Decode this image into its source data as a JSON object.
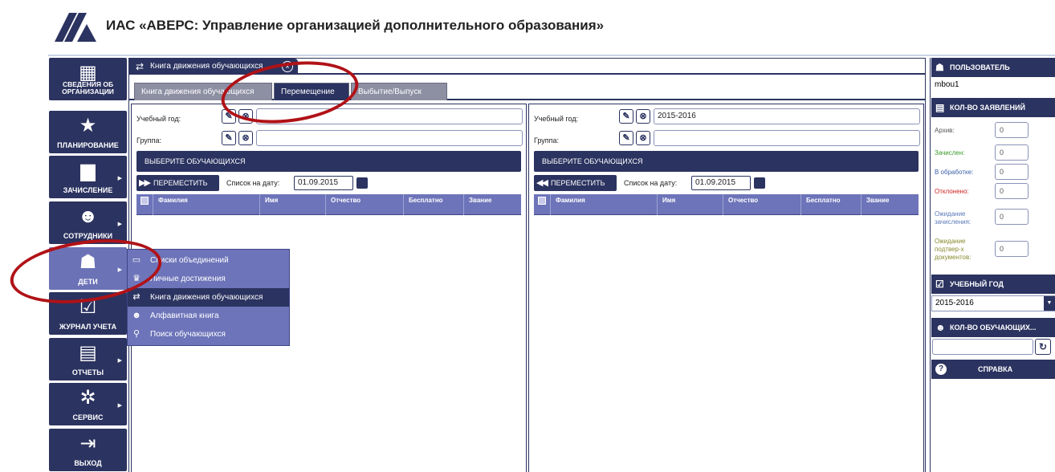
{
  "app": {
    "title": "ИАС «АВЕРС: Управление организацией дополнительного образования»"
  },
  "nav": [
    {
      "label": "СВЕДЕНИЯ ОБ ОРГАНИЗАЦИИ",
      "icon": "building-icon",
      "glyph": "▦"
    },
    {
      "label": "ПЛАНИРОВАНИЕ",
      "icon": "star-icon",
      "glyph": "★"
    },
    {
      "label": "ЗАЧИСЛЕНИЕ",
      "icon": "briefcase-icon",
      "glyph": "▆"
    },
    {
      "label": "СОТРУДНИКИ",
      "icon": "people-icon",
      "glyph": "☻"
    },
    {
      "label": "ДЕТИ",
      "icon": "person-icon",
      "glyph": "☗"
    },
    {
      "label": "ЖУРНАЛ УЧЕТА",
      "icon": "checkbox-icon",
      "glyph": "☑"
    },
    {
      "label": "ОТЧЕТЫ",
      "icon": "printer-icon",
      "glyph": "▤"
    },
    {
      "label": "СЕРВИС",
      "icon": "gears-icon",
      "glyph": "✲"
    },
    {
      "label": "ВЫХОД",
      "icon": "exit-icon",
      "glyph": "⇥"
    }
  ],
  "flyout": [
    {
      "label": "Списки объединений",
      "icon": "book-icon",
      "glyph": "▭"
    },
    {
      "label": "Личные достижения",
      "icon": "trophy-icon",
      "glyph": "♛"
    },
    {
      "label": "Книга движения обучающихся",
      "icon": "swap-icon",
      "glyph": "⇄"
    },
    {
      "label": "Алфавитная книга",
      "icon": "group-icon",
      "glyph": "☻"
    },
    {
      "label": "Поиск обучающихся",
      "icon": "search-icon",
      "glyph": "⚲"
    }
  ],
  "window": {
    "title": "Книга движения обучающихся",
    "close": "×"
  },
  "tabs": [
    "Книга движения обучающихся",
    "Перемещение",
    "Выбытие/Выпуск"
  ],
  "left": {
    "year_label": "Учебный год:",
    "year_value": "",
    "group_label": "Группа:",
    "group_value": "",
    "section": "ВЫБЕРИТЕ ОБУЧАЮЩИХСЯ",
    "move": "ПЕРЕМЕСТИТЬ",
    "date_label": "Список на дату:",
    "date": "01.09.2015"
  },
  "right": {
    "year_label": "Учебный год:",
    "year_value": "2015-2016",
    "group_label": "Группа:",
    "group_value": "",
    "section": "ВЫБЕРИТЕ ОБУЧАЮЩИХСЯ",
    "move": "ПЕРЕМЕСТИТЬ",
    "date_label": "Список на дату:",
    "date": "01.09.2015"
  },
  "columns": [
    "Фамилия",
    "Имя",
    "Отчество",
    "Бесплатно",
    "Звание"
  ],
  "side": {
    "user_header": "ПОЛЬЗОВАТЕЛЬ",
    "user": "mbou1",
    "count_header": "КОЛ-ВО ЗАЯВЛЕНИЙ",
    "counts": [
      {
        "label": "Архив:",
        "value": "0",
        "color": "#555555"
      },
      {
        "label": "Зачислен:",
        "value": "0",
        "color": "#3a9a2a"
      },
      {
        "label": "В обработке:",
        "value": "0",
        "color": "#3a5fa8"
      },
      {
        "label": "Отклонено:",
        "value": "0",
        "color": "#d02020"
      },
      {
        "label": "Ожидание зачисления:",
        "value": "0",
        "color": "#5a7ab8"
      },
      {
        "label": "Ожидание подтвер-х документов:",
        "value": "0",
        "color": "#8a8a30"
      }
    ],
    "year_header": "УЧЕБНЫЙ ГОД",
    "year": "2015-2016",
    "students_header": "КОЛ-ВО ОБУЧАЮЩИХ...",
    "students": "",
    "help": "СПРАВКА"
  }
}
